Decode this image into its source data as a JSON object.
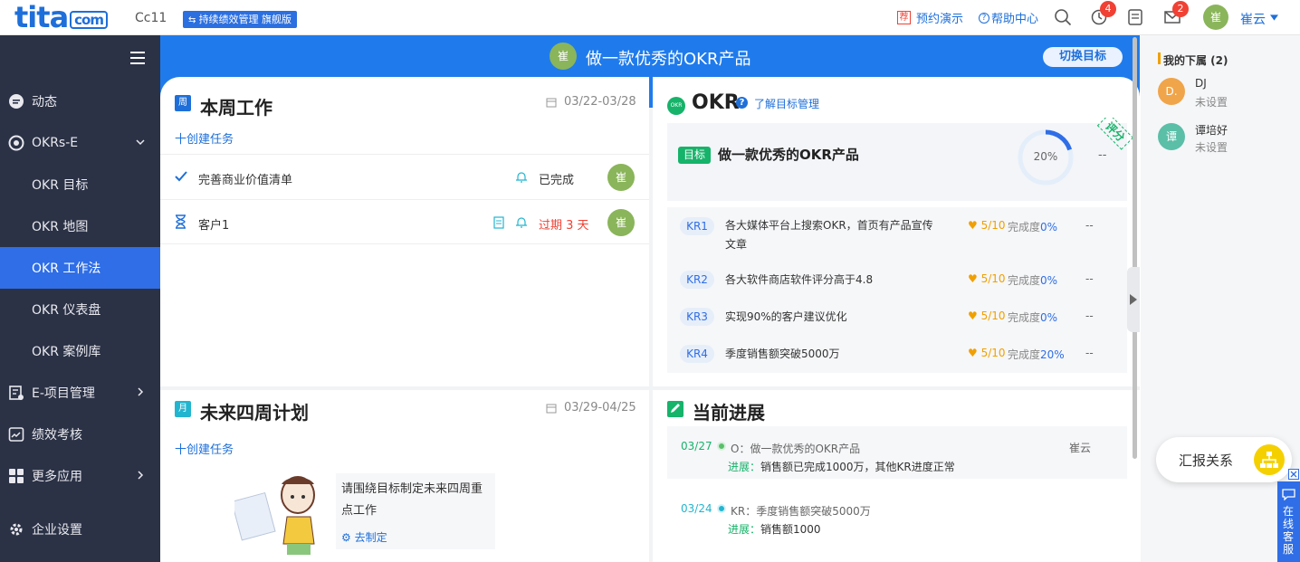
{
  "header": {
    "logo_text": "tita",
    "logo_com": "com",
    "company": "Cc11",
    "version_badge": "持续绩效管理 旗舰版",
    "demo_link": "预约演示",
    "demo_icon_char": "荐",
    "help_link": "帮助中心",
    "notif_badge": "4",
    "mail_badge": "2",
    "user_avatar": "崔",
    "user_name": "崔云"
  },
  "sidebar": {
    "items": [
      {
        "label": "动态",
        "icon": "activity-icon"
      },
      {
        "label": "OKRs-E",
        "icon": "okr-icon"
      },
      {
        "label": "OKR 目标"
      },
      {
        "label": "OKR 地图"
      },
      {
        "label": "OKR 工作法"
      },
      {
        "label": "OKR 仪表盘"
      },
      {
        "label": "OKR 案例库"
      },
      {
        "label": "E-项目管理",
        "icon": "project-icon"
      },
      {
        "label": "绩效考核",
        "icon": "performance-icon"
      },
      {
        "label": "更多应用",
        "icon": "apps-icon"
      },
      {
        "label": "企业设置",
        "icon": "gear-icon"
      }
    ]
  },
  "banner": {
    "avatar": "崔",
    "title": "做一款优秀的OKR产品",
    "switch_button": "切换目标"
  },
  "weekly": {
    "icon_char": "周",
    "title": "本周工作",
    "date_range": "03/22-03/28",
    "create_link": "十创建任务",
    "tasks": [
      {
        "name": "完善商业价值清单",
        "status": "已完成",
        "avatar": "崔"
      },
      {
        "name": "客户1",
        "status": "过期 3 天",
        "avatar": "崔"
      }
    ]
  },
  "okr": {
    "badge": "OKR",
    "title": "OKR",
    "learn_link": "了解目标管理",
    "objective_tag": "目标",
    "objective": "做一款优秀的OKR产品",
    "progress": "20%",
    "progress_value": 0.2,
    "rate_corner": "评分",
    "rate_dash": "--",
    "krs": [
      {
        "tag": "KR1",
        "text": "各大媒体平台上搜索OKR，首页有产品宣传文章",
        "score": "5/10",
        "progress_label": "完成度",
        "progress": "0%",
        "dash": "--"
      },
      {
        "tag": "KR2",
        "text": "各大软件商店软件评分高于4.8",
        "score": "5/10",
        "progress_label": "完成度",
        "progress": "0%",
        "dash": "--"
      },
      {
        "tag": "KR3",
        "text": "实现90%的客户建议优化",
        "score": "5/10",
        "progress_label": "完成度",
        "progress": "0%",
        "dash": "--"
      },
      {
        "tag": "KR4",
        "text": "季度销售额突破5000万",
        "score": "5/10",
        "progress_label": "完成度",
        "progress": "20%",
        "dash": "--"
      }
    ]
  },
  "future": {
    "icon_char": "月",
    "title": "未来四周计划",
    "date_range": "03/29-04/25",
    "create_link": "十创建任务",
    "tip": "请围绕目标制定未来四周重点工作",
    "tip_link": "去制定"
  },
  "progress_section": {
    "title": "当前进展",
    "entries": [
      {
        "date": "03/27",
        "target": "O：做一款优秀的OKR产品",
        "user": "崔云",
        "label": "进展：",
        "content": "销售额已完成1000万，其他KR进度正常",
        "dot_color": "#5bbf6a"
      },
      {
        "date": "03/24",
        "target": "KR：季度销售额突破5000万",
        "user": "",
        "label": "进展：",
        "content": "销售额1000",
        "dot_color": "#22b5cf"
      }
    ]
  },
  "subordinates": {
    "title": "我的下属 (2)",
    "people": [
      {
        "avatar": "D.",
        "name": "DJ",
        "status": "未设置",
        "color": "#f0a54a"
      },
      {
        "avatar": "谭",
        "name": "谭培好",
        "status": "未设置",
        "color": "#5bbfa8"
      }
    ]
  },
  "report_button": "汇报关系",
  "online_service": "在线客服",
  "colors": {
    "primary": "#1f7bec",
    "sidebar": "#2b3246",
    "active": "#2f6ee6",
    "overdue": "#f04134",
    "score": "#f0a000"
  }
}
